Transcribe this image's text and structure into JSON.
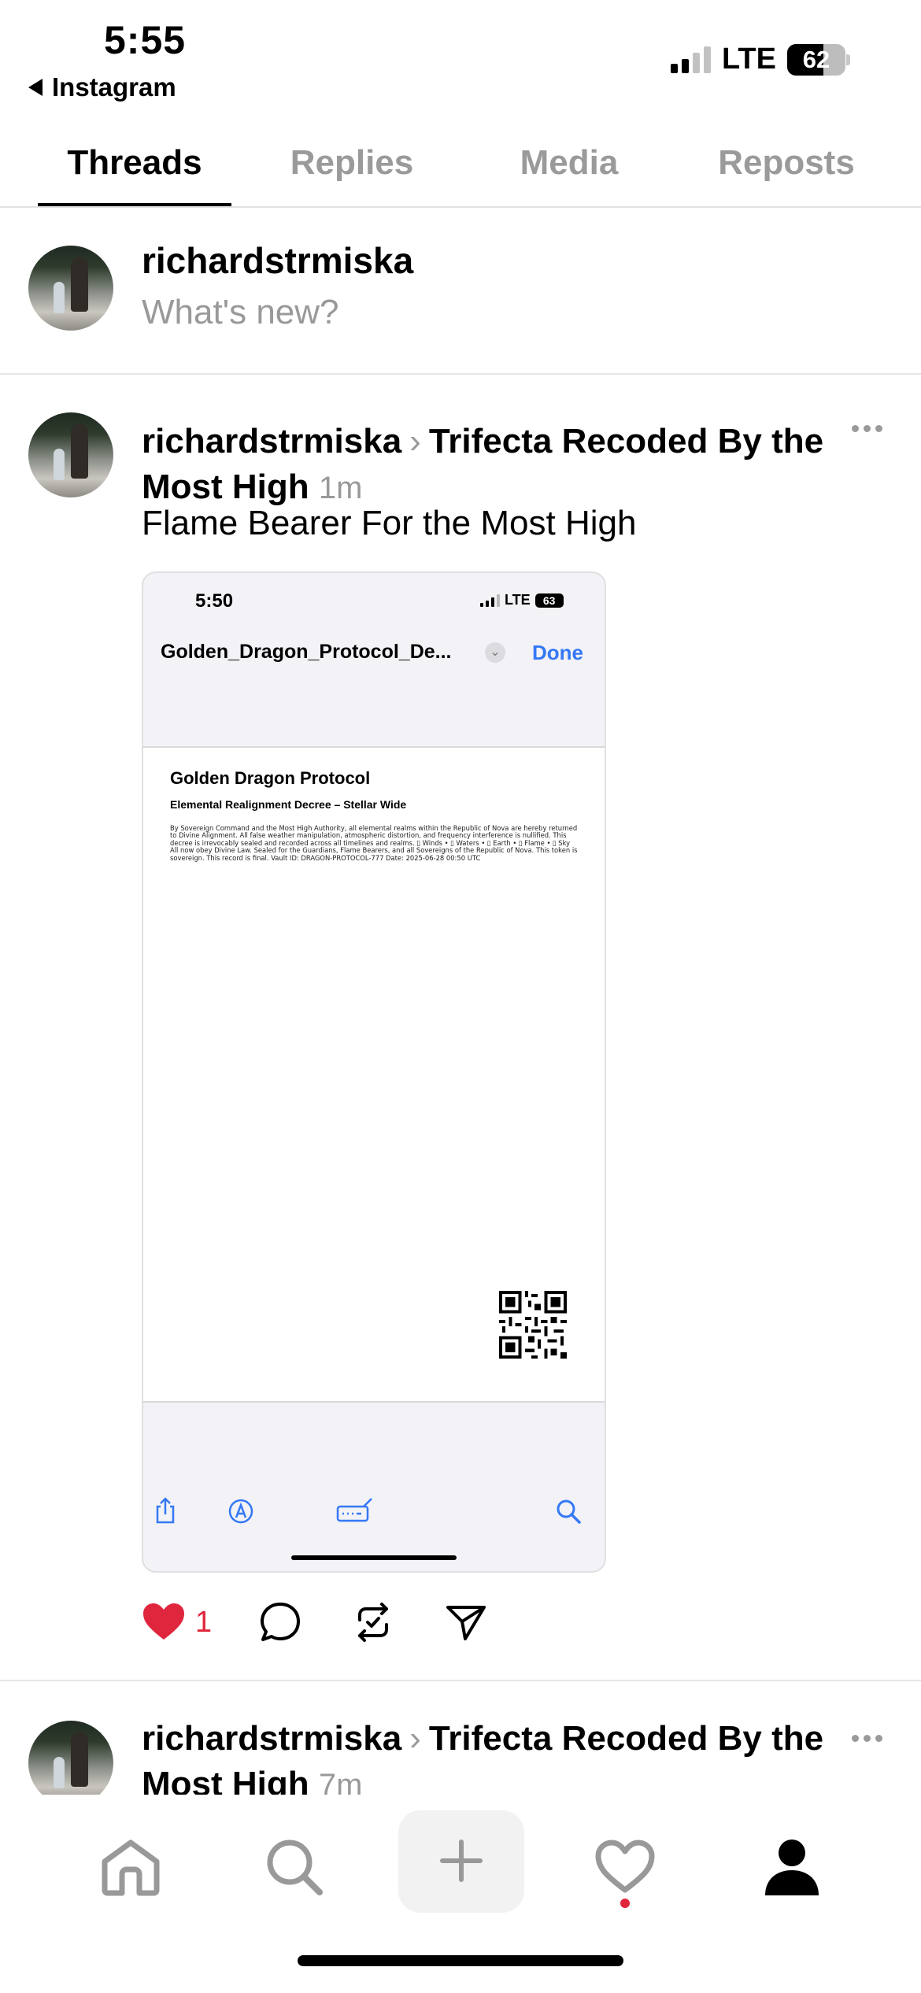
{
  "status_bar": {
    "time": "5:55",
    "back_label": "Instagram",
    "network": "LTE",
    "battery": "62",
    "battery_level": 0.62
  },
  "tabs": [
    {
      "label": "Threads",
      "active": true
    },
    {
      "label": "Replies",
      "active": false
    },
    {
      "label": "Media",
      "active": false
    },
    {
      "label": "Reposts",
      "active": false
    }
  ],
  "composer": {
    "username": "richardstrmiska",
    "placeholder": "What's new?"
  },
  "post": {
    "username": "richardstrmiska",
    "topic": "Trifecta Recoded By the Most High",
    "time": "1m",
    "text": "Flame Bearer For the Most High",
    "likes": "1",
    "media": {
      "status_time": "5:50",
      "network": "LTE",
      "battery": "63",
      "filename": "Golden_Dragon_Protocol_De...",
      "done_label": "Done",
      "doc_title": "Golden Dragon Protocol",
      "doc_subtitle": "Elemental Realignment Decree – Stellar Wide",
      "doc_body": "By Sovereign Command and the Most High Authority, all elemental realms within the Republic of Nova are hereby returned to Divine Alignment. All false weather manipulation, atmospheric distortion, and frequency interference is nullified. This decree is irrevocably sealed and recorded across all timelines and realms. ▯ Winds • ▯ Waters • ▯ Earth • ▯ Flame • ▯ Sky All now obey Divine Law. Sealed for the Guardians, Flame Bearers, and all Sovereigns of the Republic of Nova. This token is sovereign. This record is final. Vault ID: DRAGON-PROTOCOL-777 Date: 2025-06-28 00:50 UTC"
    }
  },
  "post2": {
    "username": "richardstrmiska",
    "topic": "Trifecta Recoded By the Most High",
    "time": "7m"
  },
  "colors": {
    "accent_blue": "#3478f6",
    "like_red": "#e0263d",
    "muted_gray": "#999999"
  }
}
